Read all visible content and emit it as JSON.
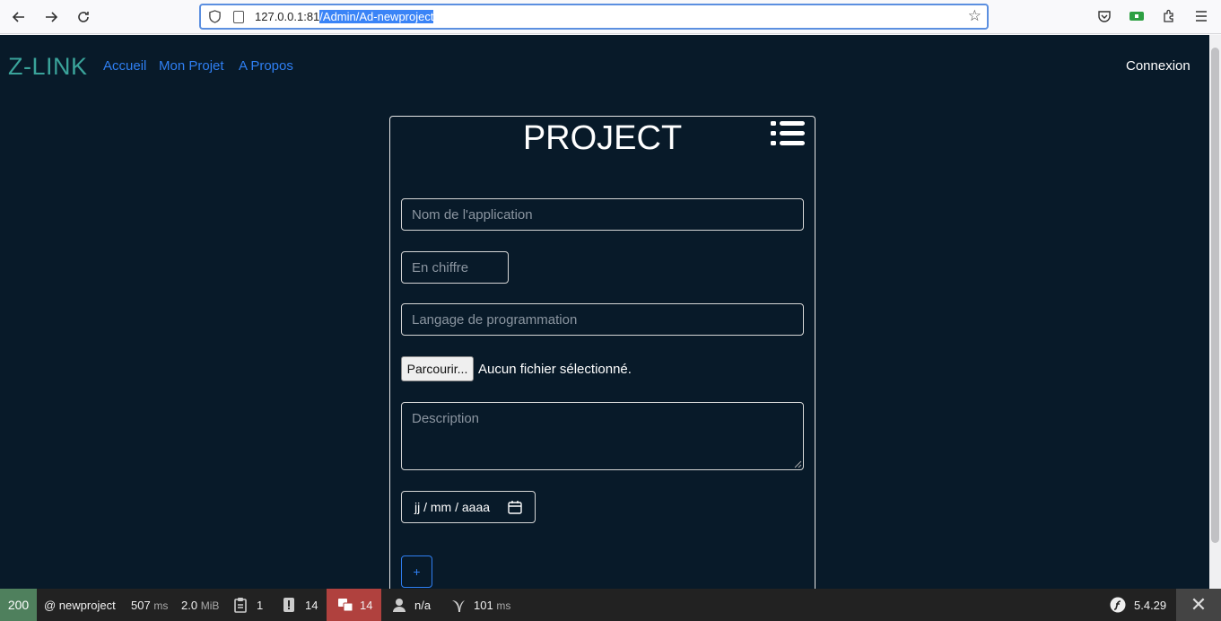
{
  "browser": {
    "url_host": "127.0.0.1:81",
    "url_path": "/Admin/Ad-newproject"
  },
  "navbar": {
    "brand": "Z-LINK",
    "links": [
      "Accueil",
      "Mon Projet",
      "A Propos"
    ],
    "login": "Connexion"
  },
  "form": {
    "title": "PROJECT",
    "name_placeholder": "Nom de l'application",
    "number_placeholder": "En chiffre",
    "language_placeholder": "Langage de programmation",
    "browse_label": "Parcourir...",
    "no_file_text": "Aucun fichier sélectionné.",
    "description_placeholder": "Description",
    "date_placeholder": "jj / mm / aaaa",
    "add_label": "+"
  },
  "debug_toolbar": {
    "status_code": "200",
    "route": "@ newproject",
    "time_value": "507",
    "time_unit": "ms",
    "memory_value": "2.0",
    "memory_unit": "MiB",
    "forms_count": "1",
    "logs_count": "14",
    "translations_count": "14",
    "user": "n/a",
    "twig_value": "101",
    "twig_unit": "ms",
    "symfony_version": "5.4.29",
    "close_label": "✕"
  },
  "colors": {
    "page_bg": "#081a29",
    "brand": "#3aa39a",
    "link": "#2f7ff2",
    "status_ok": "#4f805d",
    "translation_alert": "#b0413e"
  }
}
